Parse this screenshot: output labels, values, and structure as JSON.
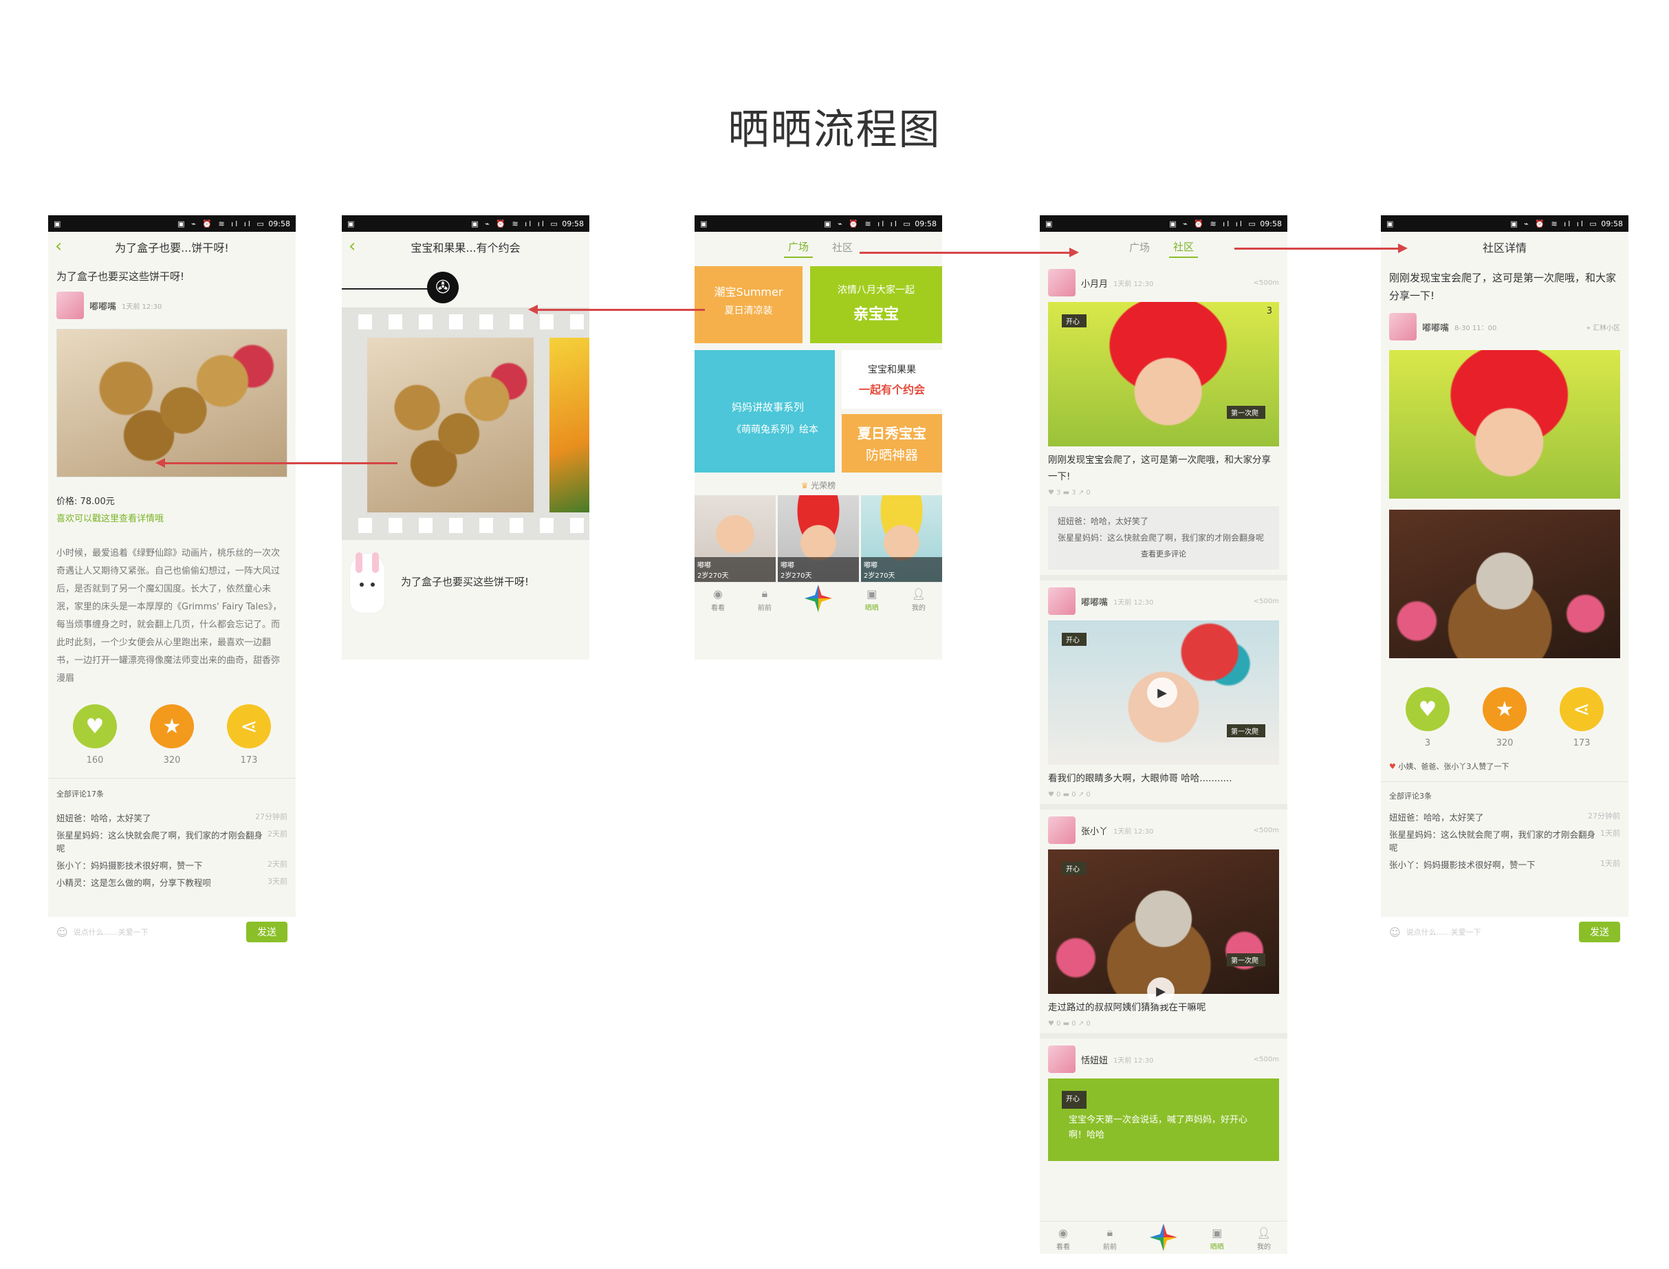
{
  "page_title": "晒晒流程图",
  "status_bar": {
    "time": "09:58",
    "icons": "▣ ⌁ ⏰ ≋ ıl ıl ▭"
  },
  "screen1": {
    "header_title": "为了盒子也要...饼干呀!",
    "post_title": "为了盒子也要买这些饼干呀!",
    "author": "嘟嘟嘴",
    "author_meta": "1天前  12:30",
    "price": "价格: 78.00元",
    "link": "喜欢可以戳这里查看详情哦",
    "body": "小时候，最爱追着《绿野仙踪》动画片，桃乐丝的一次次奇遇让人又期待又紧张。自己也偷偷幻想过，一阵大风过后，是否就到了另一个魔幻国度。长大了，依然童心未泯，家里的床头是一本厚厚的《Grimms' Fairy Tales》，每当烦事缠身之时，就会翻上几页，什么都会忘记了。而此时此刻，一个少女便会从心里跑出来，最喜欢一边翻书，一边打开一罐漂亮得像魔法师变出来的曲奇，甜香弥漫眉",
    "like_count": "160",
    "star_count": "320",
    "share_count": "173",
    "comments_title": "全部评论17条",
    "comments": [
      {
        "text": "妞妞爸：哈哈，太好笑了",
        "time": "27分钟前"
      },
      {
        "text": "张星星妈妈：这么快就会爬了啊，我们家的才刚会翻身呢",
        "time": "2天前"
      },
      {
        "text": "张小丫：妈妈摄影技术很好啊，赞一下",
        "time": "2天前"
      },
      {
        "text": "小精灵：这是怎么做的啊，分享下教程呗",
        "time": "3天前"
      }
    ],
    "input_placeholder": "说点什么......关爱一下",
    "send": "发送"
  },
  "screen2": {
    "header_title": "宝宝和果果...有个约会",
    "caption": "为了盒子也要买这些饼干呀!"
  },
  "screen3": {
    "tab_plaza": "广场",
    "tab_community": "社区",
    "banner1_line1": "潮宝Summer",
    "banner1_line2": "夏日清凉装",
    "banner2_line1": "浓情八月大家一起",
    "banner2_line2": "亲宝宝",
    "banner3_line1": "妈妈讲故事系列",
    "banner3_line2": "《萌萌兔系列》绘本",
    "banner4_line1": "宝宝和果果",
    "banner4_line2": "一起有个约会",
    "banner5_line1": "夏日秀宝宝",
    "banner5_line2": "防晒神器",
    "ranking_title": "光荣榜",
    "rank": [
      {
        "name": "嘟嘟",
        "age": "2岁270天"
      },
      {
        "name": "嘟嘟",
        "age": "2岁270天"
      },
      {
        "name": "嘟嘟",
        "age": "2岁270天"
      }
    ],
    "tabs": [
      "看看",
      "前前",
      "",
      "晒晒",
      "我的"
    ]
  },
  "screen4": {
    "tab_plaza": "广场",
    "tab_community": "社区",
    "posts": [
      {
        "author": "小月月",
        "meta": "1天前  12:30",
        "dist": "<500m",
        "text": "刚刚发现宝宝会爬了，这可是第一次爬哦，和大家分享一下!",
        "stats": "♥ 3   ▬ 3   ↗ 0"
      },
      {
        "author": "嘟嘟嘴",
        "meta": "1天前  12:30",
        "dist": "<500m",
        "text": "看我们的眼睛多大啊，大眼帅哥 哈哈...........",
        "stats": "♥ 0   ▬ 0   ↗ 0"
      },
      {
        "author": "张小丫",
        "meta": "1天前  12:30",
        "dist": "<500m",
        "text": "走过路过的叔叔阿姨们猜猜我在干嘛呢",
        "stats": "♥ 0   ▬ 0   ↗ 0"
      },
      {
        "author": "恬妞妞",
        "meta": "1天前  12:30",
        "dist": "<500m",
        "text": "宝宝今天第一次会说话，喊了声妈妈，好开心啊！哈哈"
      }
    ],
    "inline_comments": [
      "妞妞爸：哈哈，太好笑了",
      "张星星妈妈：这么快就会爬了啊，我们家的才刚会翻身呢"
    ],
    "more_comments": "查看更多评论",
    "tag_open": "开心",
    "tag_first": "第一次爬",
    "count_badge": "3",
    "tabs": [
      "看看",
      "前前",
      "",
      "晒晒",
      "我的"
    ]
  },
  "screen5": {
    "header_title": "社区详情",
    "post_text": "刚刚发现宝宝会爬了，这可是第一次爬哦，和大家分享一下!",
    "author": "嘟嘟嘴",
    "author_meta": "8-30  11：00",
    "location": "汇林小区",
    "like_count": "3",
    "star_count": "320",
    "share_count": "173",
    "liked_by": "小姨、爸爸、张小丫3人赞了一下",
    "comments_title": "全部评论3条",
    "comments": [
      {
        "text": "妞妞爸：哈哈，太好笑了",
        "time": "27分钟前"
      },
      {
        "text": "张星星妈妈：这么快就会爬了啊，我们家的才刚会翻身呢",
        "time": "1天前"
      },
      {
        "text": "张小丫：妈妈摄影技术很好啊，赞一下",
        "time": "1天前"
      }
    ],
    "input_placeholder": "说点什么......关爱一下",
    "send": "发送"
  },
  "colors": {
    "accent_green": "#8bbf29",
    "arrow_red": "#d64545",
    "like_green": "#a8cf38",
    "star_orange": "#f39a1d",
    "share_yellow": "#f6c524"
  }
}
